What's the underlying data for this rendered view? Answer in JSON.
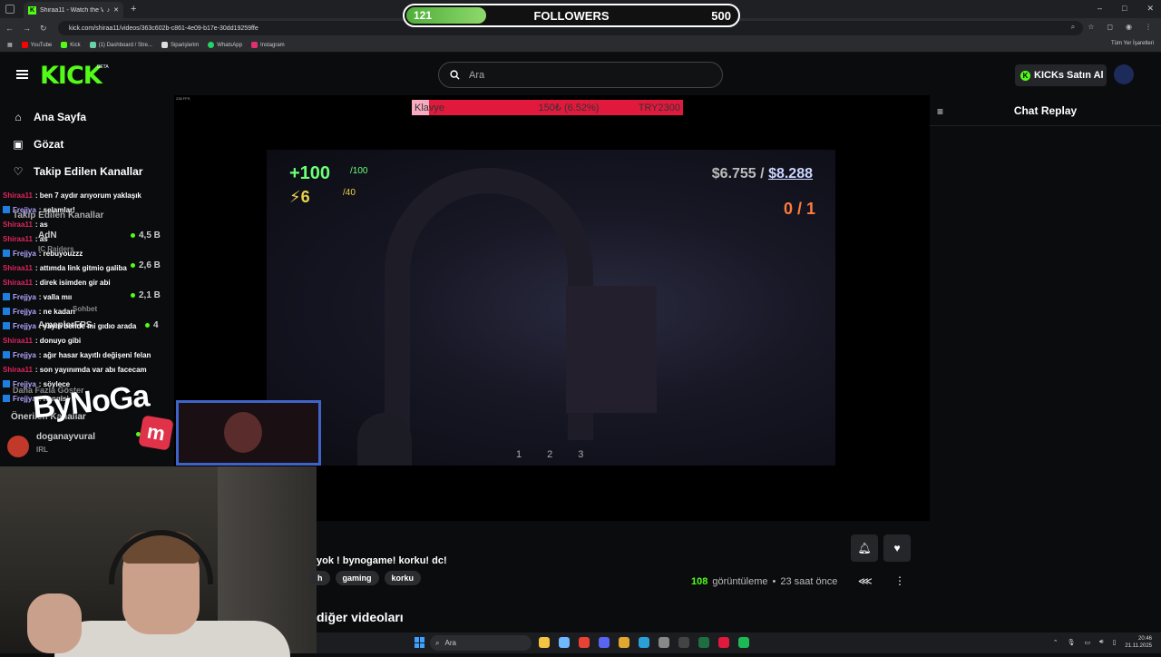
{
  "browser": {
    "tab_title": "Shiraa11 - Watch the VOD -",
    "new_tab": "+",
    "window_controls": [
      "–",
      "□",
      "✕"
    ],
    "url": "kick.com/shiraa11/videos/363c602b-c861-4e09-b17e-30dd19259ffe",
    "bookmarks": [
      {
        "label": "YouTube",
        "color": "#ff0000"
      },
      {
        "label": "Kick",
        "color": "#53fc18"
      },
      {
        "label": "(1) Dashboard / Stre...",
        "color": "#6cd1a8"
      },
      {
        "label": "Siparişlerim",
        "color": "#dddddd"
      },
      {
        "label": "WhatsApp",
        "color": "#25d366"
      },
      {
        "label": "Instagram",
        "color": "#e1306c"
      }
    ],
    "bookmarks_right": "Tüm Yer İşaretleri"
  },
  "followers_overlay": {
    "current": "121",
    "label": "FOLLOWERS",
    "goal": "500",
    "progress": 0.242
  },
  "header": {
    "logo": "KICK",
    "beta": "BETA",
    "search_placeholder": "Ara",
    "buy_button": "KICKs Satın Al"
  },
  "sidebar": {
    "nav": [
      {
        "label": "Ana Sayfa",
        "icon": "home-icon",
        "glyph": "⌂"
      },
      {
        "label": "Gözat",
        "icon": "browse-icon",
        "glyph": "▣"
      },
      {
        "label": "Takip Edilen Kanallar",
        "icon": "heart-icon",
        "glyph": "♡"
      }
    ],
    "followed_header": "Takip Edilen Kanallar",
    "channels": [
      {
        "name": "AdN",
        "viewers": "4,5 B"
      },
      {
        "name": "",
        "viewers": "2,6 B"
      },
      {
        "name": "",
        "viewers": "2,1 B"
      },
      {
        "name": "AmeplerFPS",
        "viewers": "4"
      },
      {
        "name": "doganayvural",
        "viewers": ""
      }
    ],
    "sub_labels": [
      "IC Raiders",
      "Sohbet",
      "IRL"
    ],
    "show_more": "Daha Fazla Göster",
    "recommended": "Önerilen Kanallar"
  },
  "chat_overlay": [
    {
      "user": "Shiraa11",
      "type": "streamer",
      "msg": ": ben 7 aydır arıyorum yaklaşık"
    },
    {
      "user": "Frejjya",
      "type": "viewer",
      "msg": ": selamlar!"
    },
    {
      "user": "Shiraa11",
      "type": "streamer",
      "msg": ": as"
    },
    {
      "user": "Shiraa11",
      "type": "streamer",
      "msg": ": as"
    },
    {
      "user": "Frejjya",
      "type": "viewer",
      "msg": ": rebuyouzzz"
    },
    {
      "user": "Shiraa11",
      "type": "streamer",
      "msg": ": attımda link gitmio galiba"
    },
    {
      "user": "Shiraa11",
      "type": "streamer",
      "msg": ": direk isimden gir abi"
    },
    {
      "user": "Frejjya",
      "type": "viewer",
      "msg": ": valla mıı"
    },
    {
      "user": "Frejjya",
      "type": "viewer",
      "msg": ": ne kadarı"
    },
    {
      "user": "Frejjya",
      "type": "viewer",
      "msg": ": yayın bende mi gıdıo arada"
    },
    {
      "user": "Shiraa11",
      "type": "streamer",
      "msg": ": donuyo gibi"
    },
    {
      "user": "Frejjya",
      "type": "viewer",
      "msg": ": ağır hasar kayıtlı değişeni felan"
    },
    {
      "user": "Shiraa11",
      "type": "streamer",
      "msg": ": son yayınımda var abı facecam"
    },
    {
      "user": "Frejjya",
      "type": "viewer",
      "msg": ": söylece"
    },
    {
      "user": "Frejjya",
      "type": "viewer",
      "msg": ": hangisi"
    }
  ],
  "donation_bar": {
    "left": "Klavye",
    "middle": "150₺ (6.52%)",
    "right": "TRY2300",
    "progress": 0.0652
  },
  "game_hud": {
    "health": "+100",
    "health_max": "/100",
    "armor": "⚡6",
    "armor_max": "/40",
    "money": "$6.755",
    "money_sep": "/",
    "money_total": "$8.288",
    "objective": "0 / 1",
    "slots": [
      "1",
      "2",
      "3"
    ],
    "fps_text": "238 FPS"
  },
  "overlay_brand": {
    "text": "ByNoGa",
    "m": "m"
  },
  "chat_replay": {
    "title": "Chat Replay"
  },
  "video": {
    "title": "yok ! bynogame! korku! dc!",
    "tags": [
      "h",
      "gaming",
      "korku"
    ],
    "views": "108",
    "views_label": "görüntüleme",
    "sep": "•",
    "time_ago": "23 saat önce",
    "other_videos": "diğer videoları"
  },
  "taskbar": {
    "search": "Ara",
    "apps": [
      {
        "name": "explorer",
        "color": "#f4c542"
      },
      {
        "name": "copilot",
        "color": "#6fb7ff"
      },
      {
        "name": "chrome",
        "color": "#e94235"
      },
      {
        "name": "discord",
        "color": "#5865f2"
      },
      {
        "name": "files",
        "color": "#e0a82e"
      },
      {
        "name": "edge",
        "color": "#2aa0d8"
      },
      {
        "name": "calculator",
        "color": "#888888"
      },
      {
        "name": "obs",
        "color": "#444444"
      },
      {
        "name": "excel",
        "color": "#1d6f42"
      },
      {
        "name": "app",
        "color": "#e0193d"
      },
      {
        "name": "spotify",
        "color": "#1db954"
      }
    ],
    "time": "20:46",
    "date": "21.11.2025"
  }
}
